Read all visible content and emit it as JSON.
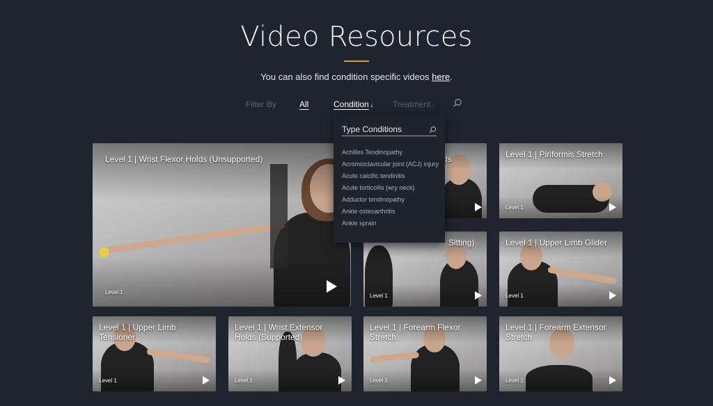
{
  "page": {
    "title": "Video Resources",
    "subtitle_text": "You can also find condition specific videos ",
    "subtitle_link": "here",
    "subtitle_end": "."
  },
  "filters": {
    "label": "Filter By",
    "all": "All",
    "condition": "Condition",
    "treatment": "Treatment",
    "arrow": "↓"
  },
  "dropdown": {
    "placeholder": "Type Conditions",
    "items": [
      "Achilles Tendinopathy",
      "Acromioclavicular joint (ACJ) injury",
      "Acute calcific tendinitis",
      "Acute torticollis (wry neck)",
      "Adductor tendinopathy",
      "Ankle osteoarthritis",
      "Ankle sprain"
    ]
  },
  "videos": [
    {
      "title": "Level 1 | Wrist Flexor Holds (Unsupported)",
      "level": "Level 1"
    },
    {
      "title": "ds",
      "level": ""
    },
    {
      "title": "Level 1 | Piriformis Stretch",
      "level": "Level 1"
    },
    {
      "title": "Sitting)",
      "level": "Level 1"
    },
    {
      "title": "Level 1 | Upper Limb Glider",
      "level": "Level 1"
    },
    {
      "title": "Level 1 | Upper Limb Tensioner",
      "level": "Level 1"
    },
    {
      "title": "Level 1 | Wrist Extensor Holds (Supported)",
      "level": "Level 1"
    },
    {
      "title": "Level 1 | Forearm Flexor Stretch",
      "level": "Level 1"
    },
    {
      "title": "Level 1 | Forearm Extensor Stretch",
      "level": "Level 1"
    }
  ],
  "colors": {
    "background": "#1f242e",
    "accent": "#d89a3a"
  },
  "icons": {
    "search": "search-icon",
    "play": "play-icon"
  }
}
